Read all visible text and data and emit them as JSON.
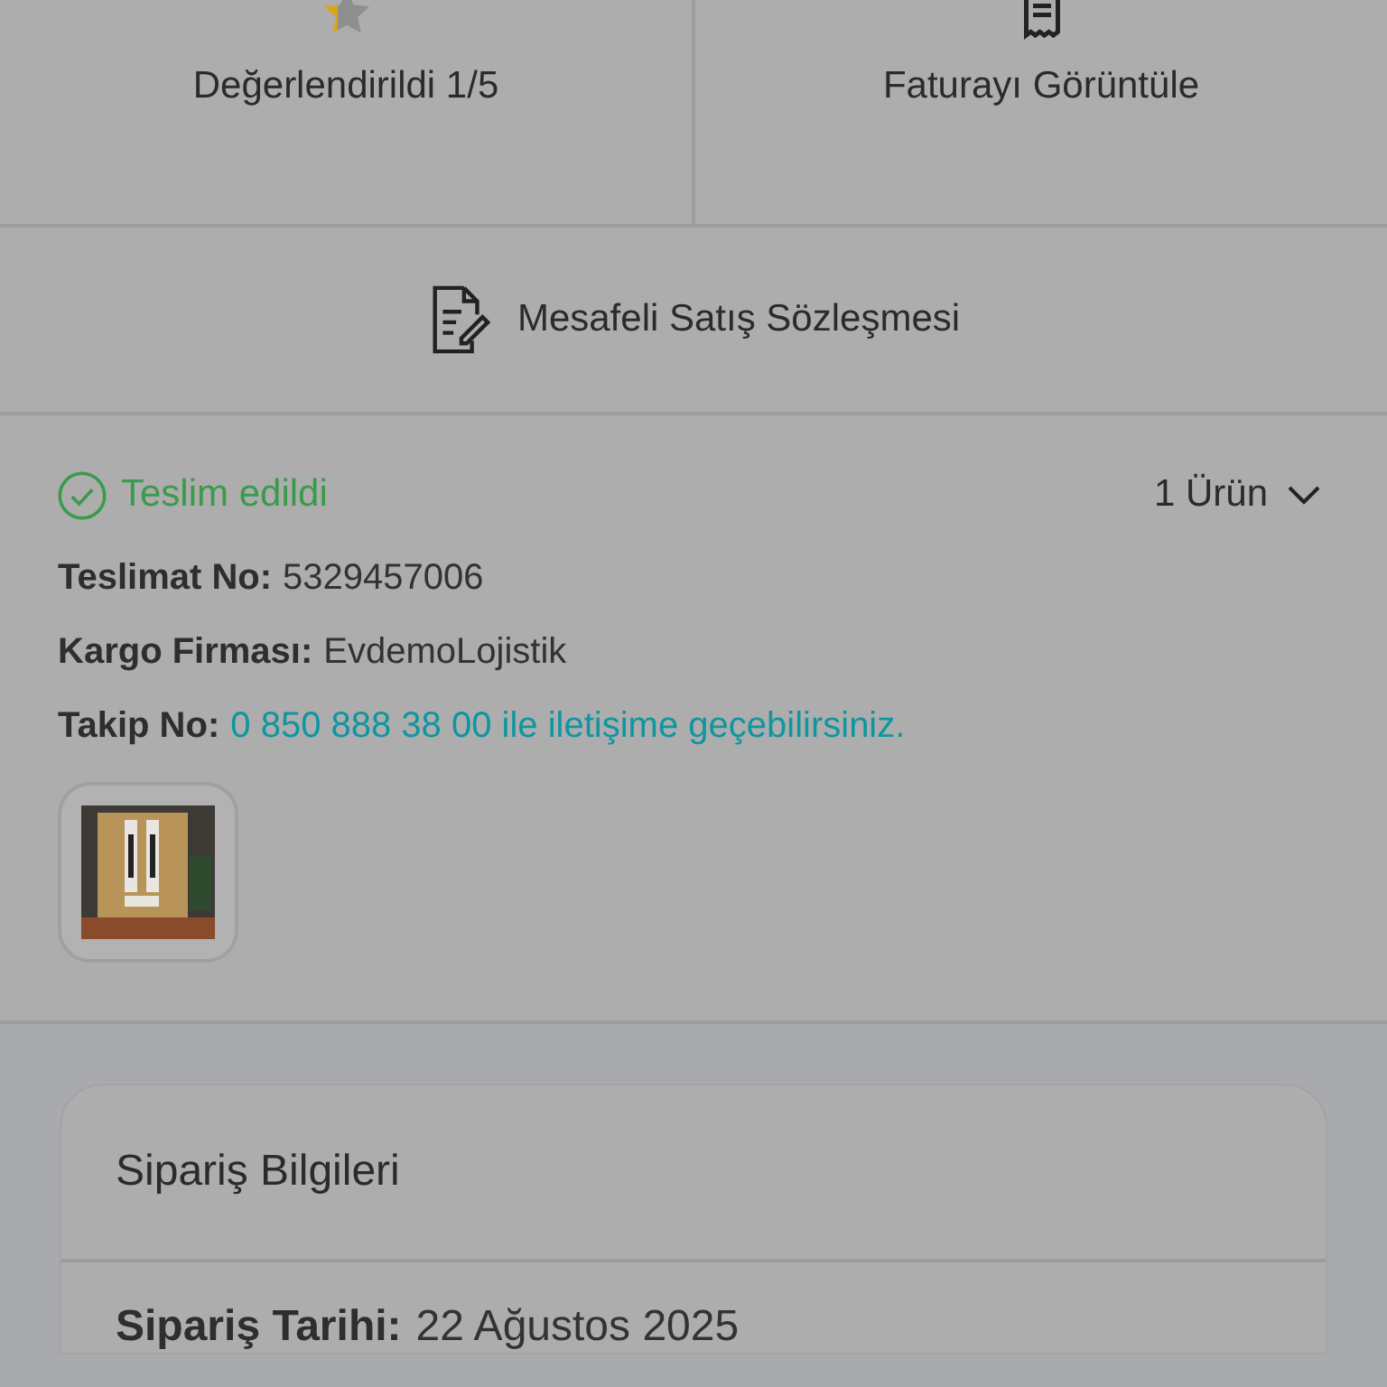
{
  "actions": [
    {
      "kind": "rating",
      "label": "Değerlendirildi 1/5"
    },
    {
      "kind": "invoice",
      "label": "Faturayı Görüntüle"
    }
  ],
  "contract": {
    "label": "Mesafeli Satış Sözleşmesi"
  },
  "delivery": {
    "status": "Teslim edildi",
    "item_count": "1 Ürün",
    "expanded": false,
    "fields": [
      {
        "label": "Teslimat No:",
        "value": "5329457006",
        "link": false
      },
      {
        "label": "Kargo Firması:",
        "value": "EvdemoLojistik",
        "link": false
      },
      {
        "label": "Takip No:",
        "value": "0 850 888 38 00 ile iletişime geçebilirsiniz.",
        "link": true
      }
    ]
  },
  "order_info": {
    "title": "Sipariş Bilgileri",
    "fields": [
      {
        "label": "Sipariş Tarihi:",
        "value": "22 Ağustos 2025"
      }
    ]
  }
}
